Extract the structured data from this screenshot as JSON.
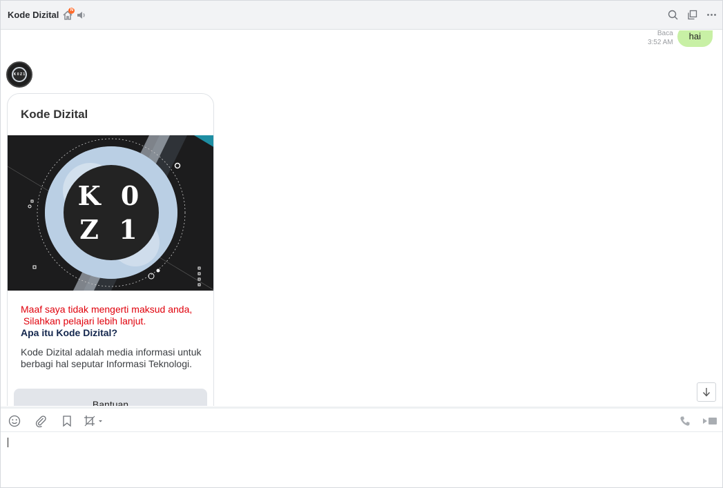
{
  "header": {
    "title": "Kode Dizital",
    "home_badge": "N",
    "icons": [
      "home-icon",
      "speaker-icon",
      "search-icon",
      "popout-icon",
      "more-icon"
    ]
  },
  "messages": {
    "outgoing": {
      "status": "Baca",
      "time": "3:52 AM",
      "text": "hai"
    },
    "avatar_text": "K 0 Z 1",
    "card": {
      "title": "Kode Dizital",
      "image_text": [
        "K 0",
        "Z 1"
      ],
      "error_line1": "Maaf saya tidak mengerti maksud anda,",
      "error_line2": " Silahkan pelajari lebih lanjut.",
      "question": "Apa itu Kode Dizital?",
      "description": "Kode Dizital adalah media informasi untuk berbagi hal seputar Informasi Teknologi.",
      "button_label": "Bantuan"
    }
  },
  "toolbar": {
    "left_icons": [
      "emoji-icon",
      "attachment-icon",
      "bookmark-icon",
      "screenshot-icon"
    ],
    "right_icons": [
      "phone-icon",
      "video-icon"
    ]
  },
  "input": {
    "value": ""
  },
  "colors": {
    "accent_badge": "#ff6a2a",
    "outgoing_bubble": "#c8f0a5",
    "error_text": "#e0000b",
    "question_text": "#13264d"
  }
}
